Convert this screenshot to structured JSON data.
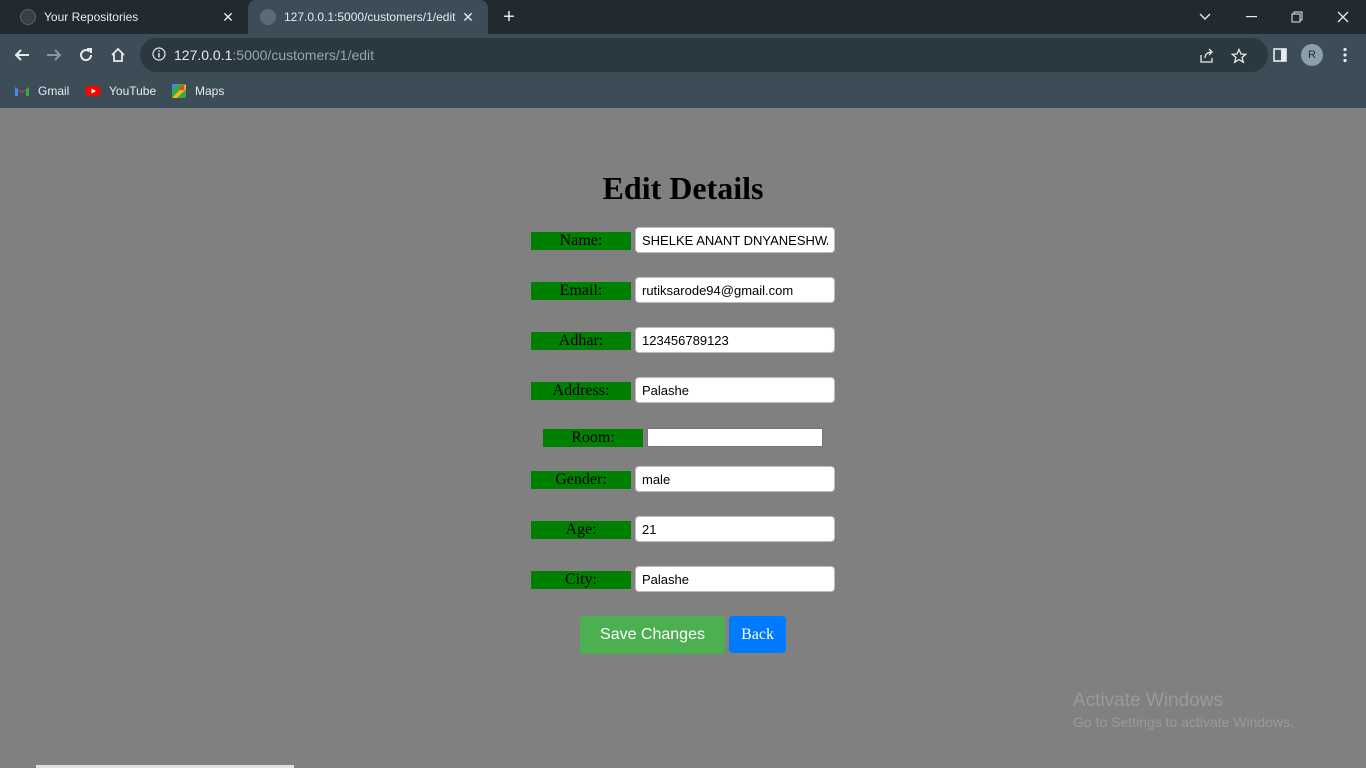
{
  "browser": {
    "tabs": [
      {
        "title": "Your Repositories",
        "icon": "github-icon"
      },
      {
        "title": "127.0.0.1:5000/customers/1/edit",
        "icon": "globe-icon"
      }
    ],
    "url_host": "127.0.0.1",
    "url_rest": ":5000/customers/1/edit",
    "profile_initial": "R",
    "bookmarks": [
      "Gmail",
      "YouTube",
      "Maps"
    ]
  },
  "page": {
    "title": "Edit Details",
    "fields": [
      {
        "label": "Name:",
        "value": "SHELKE ANANT DNYANESHWAR"
      },
      {
        "label": "Email:",
        "value": "rutiksarode94@gmail.com"
      },
      {
        "label": "Adhar:",
        "value": "123456789123"
      },
      {
        "label": "Address:",
        "value": "Palashe"
      },
      {
        "label": "Room:",
        "value": ""
      },
      {
        "label": "Gender:",
        "value": "male"
      },
      {
        "label": "Age:",
        "value": "21"
      },
      {
        "label": "City:",
        "value": "Palashe"
      }
    ],
    "save_label": "Save Changes",
    "back_label": "Back"
  },
  "watermark": {
    "line1": "Activate Windows",
    "line2": "Go to Settings to activate Windows."
  },
  "colors": {
    "label_bg": "#008000",
    "save_button": "#4caf50",
    "back_button": "#007bff",
    "page_bg": "#808080"
  }
}
